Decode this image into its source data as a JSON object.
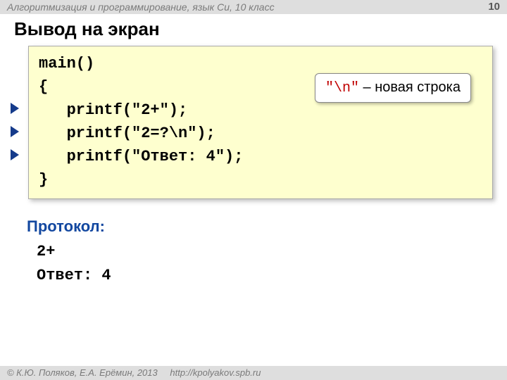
{
  "header": {
    "course": "Алгоритмизация и программирование, язык Си, 10 класс",
    "page": "10"
  },
  "title": "Вывод на экран",
  "code": {
    "l1": "main()",
    "l2": "{",
    "l3": "   printf(\"2+\");",
    "l4": "   printf(\"2=?\\n\");",
    "l5": "   printf(\"Ответ: 4\");",
    "l6": "}"
  },
  "callout": {
    "mono": "\"\\n\"",
    "rest": " – новая строка"
  },
  "protocol": {
    "label": "Протокол:",
    "line1": "2+",
    "line2": "Ответ: 4"
  },
  "footer": {
    "copyright": "© К.Ю. Поляков, Е.А. Ерёмин, 2013",
    "url": "http://kpolyakov.spb.ru"
  }
}
